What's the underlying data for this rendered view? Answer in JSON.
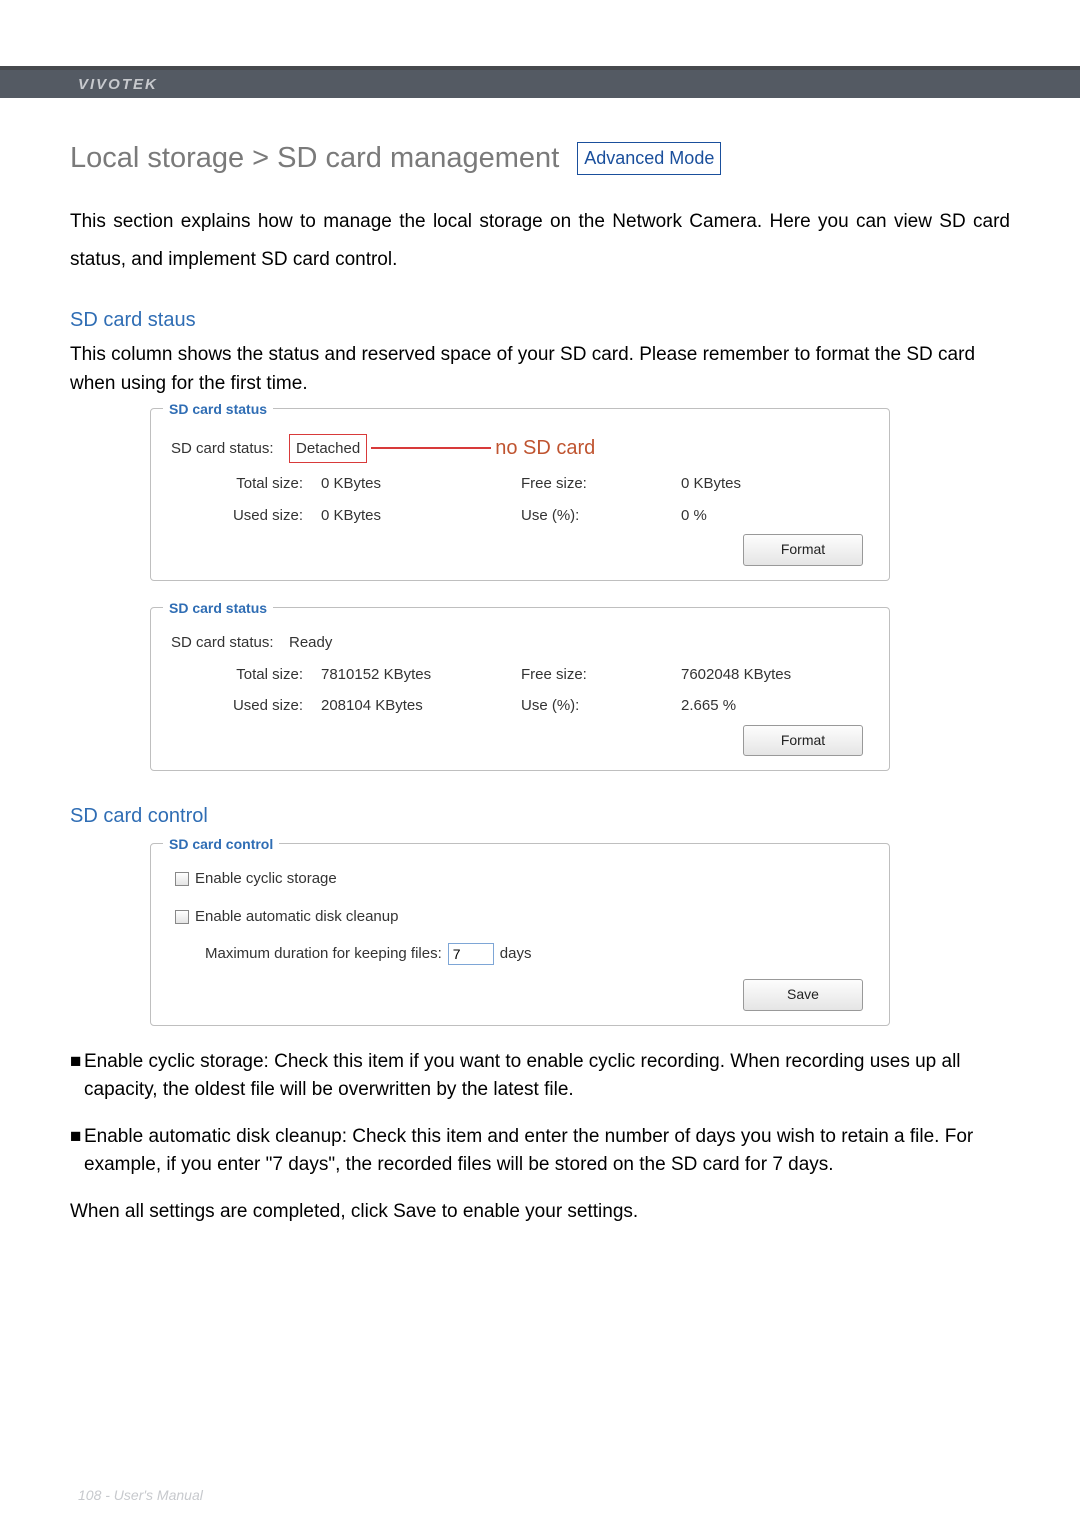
{
  "header": {
    "brand": "VIVOTEK"
  },
  "title": {
    "text": "Local storage > SD card management",
    "badge": "Advanced Mode"
  },
  "intro": "This section explains how to manage the local storage on the Network Camera. Here you can view SD card status, and implement SD card control.",
  "sd_status": {
    "heading": "SD card staus",
    "desc": "This column shows the status and reserved space of your SD card. Please remember to format the SD card when using for the first time.",
    "legend": "SD card status",
    "labels": {
      "status": "SD card status:",
      "total": "Total size:",
      "used": "Used size:",
      "free": "Free size:",
      "use_pct": "Use (%):",
      "format_btn": "Format"
    },
    "detached": {
      "status_value": "Detached",
      "callout": "no SD card",
      "total": "0  KBytes",
      "free": "0  KBytes",
      "used": "0  KBytes",
      "use_pct": "0 %"
    },
    "ready": {
      "status_value": "Ready",
      "total": "7810152  KBytes",
      "free": "7602048  KBytes",
      "used": "208104  KBytes",
      "use_pct": "2.665 %"
    }
  },
  "sd_control": {
    "heading": "SD card control",
    "legend": "SD card control",
    "cyclic_label": "Enable cyclic storage",
    "cleanup_label": "Enable automatic disk cleanup",
    "max_dur_label": "Maximum duration for keeping files:",
    "max_dur_value": "7",
    "days_label": "days",
    "save_btn": "Save"
  },
  "bullets": {
    "cyclic": "Enable cyclic storage: Check this item if you want to enable cyclic recording. When recording uses up all capacity, the oldest file will be overwritten by the latest file.",
    "cleanup": "Enable automatic disk cleanup: Check this item and enter the number of days you wish to retain a file. For example, if you enter \"7 days\", the recorded files will be stored on the SD card for 7 days."
  },
  "closing": "When all settings are completed, click Save to enable your settings.",
  "footer": "108 - User's Manual"
}
